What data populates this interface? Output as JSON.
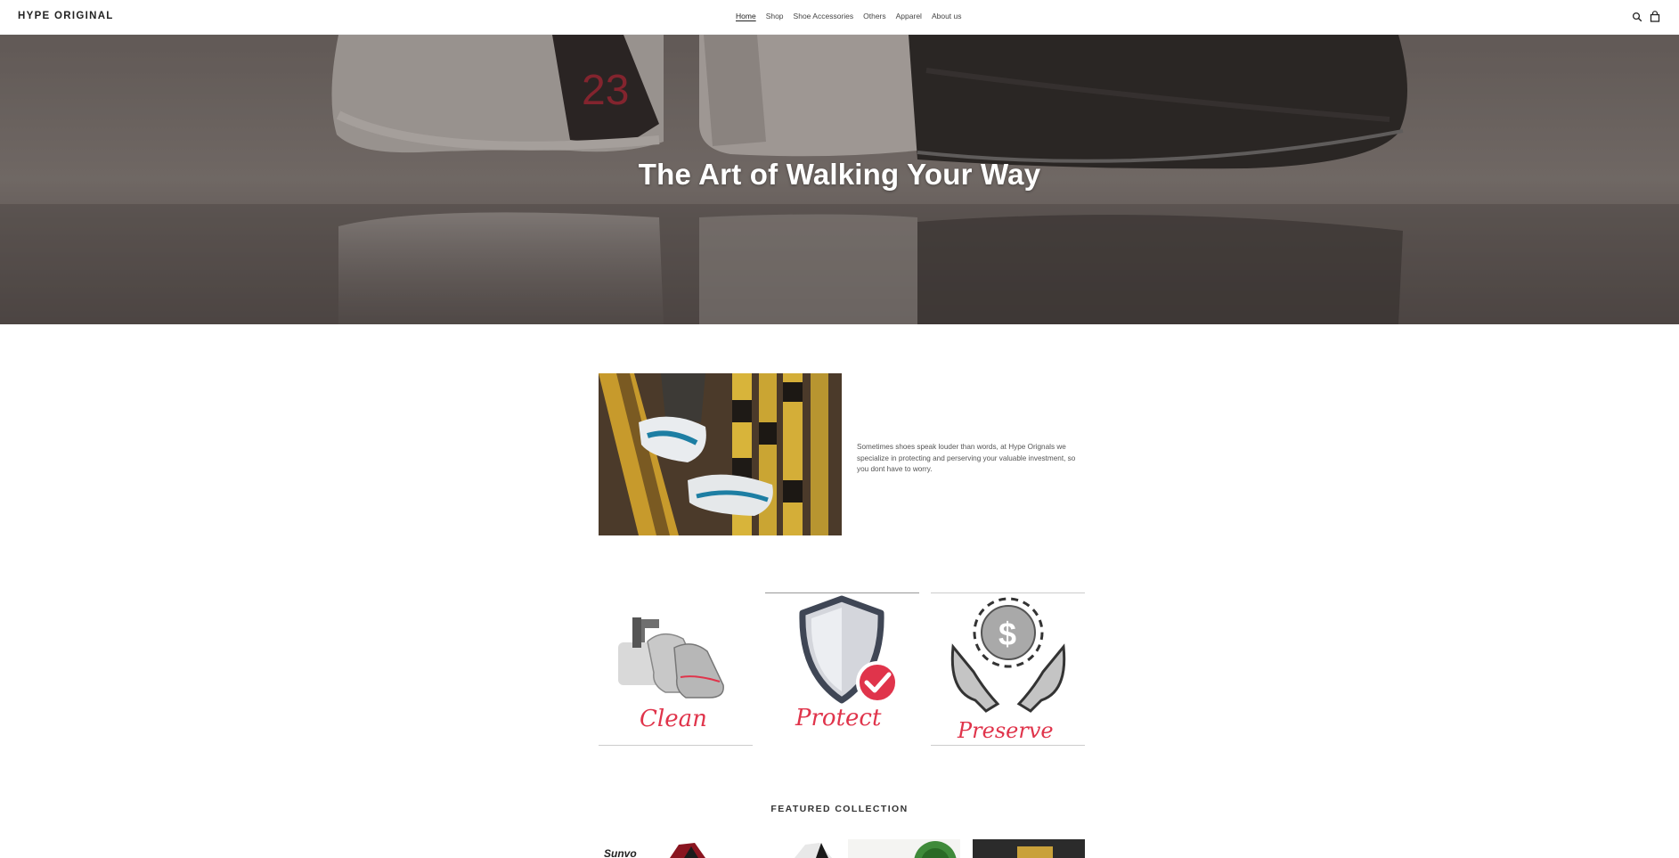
{
  "header": {
    "logo": "HYPE ORIGINAL",
    "nav": [
      "Home",
      "Shop",
      "Shoe Accessories",
      "Others",
      "Apparel",
      "About us"
    ],
    "active_nav": "Home",
    "icons": [
      "search-icon",
      "cart-icon"
    ]
  },
  "hero": {
    "title": "The Art of Walking Your Way",
    "jersey_number": "23"
  },
  "about": {
    "text": "Sometimes shoes speak louder than words, at Hype Orignals we specialize in protecting and perserving your valuable investment, so you dont have to worry."
  },
  "features": {
    "clean": "Clean",
    "protect": "Protect",
    "preserve": "Preserve"
  },
  "featured": {
    "title": "FEATURED COLLECTION",
    "product1_brand": "Sunvo"
  },
  "colors": {
    "accent_red": "#e0344b",
    "text_dark": "#222222"
  }
}
